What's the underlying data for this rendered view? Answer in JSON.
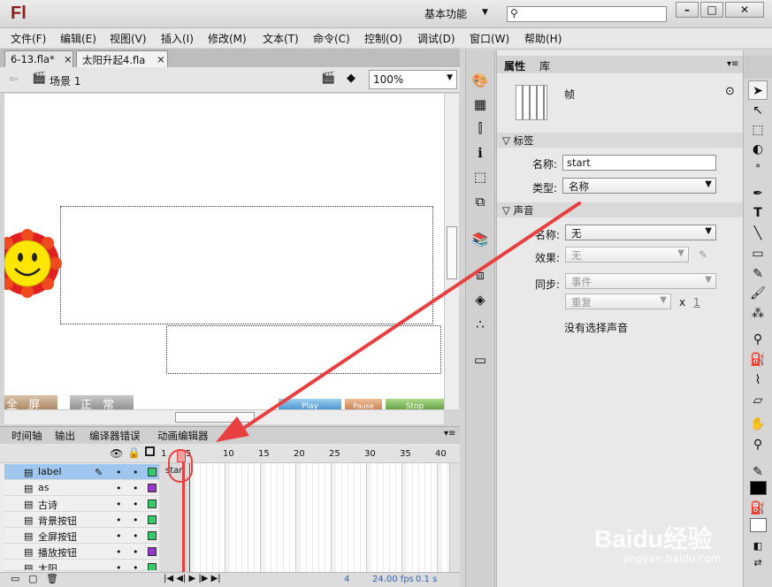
{
  "app": {
    "logo": "Fl",
    "workspace": "基本功能",
    "search_icon": "search-icon",
    "window_buttons": [
      "minimize",
      "maximize",
      "close"
    ]
  },
  "menu": [
    "文件(F)",
    "编辑(E)",
    "视图(V)",
    "插入(I)",
    "修改(M)",
    "文本(T)",
    "命令(C)",
    "控制(O)",
    "调试(D)",
    "窗口(W)",
    "帮助(H)"
  ],
  "tabs": [
    {
      "label": "6-13.fla*",
      "close": "×"
    },
    {
      "label": "太阳升起4.fla",
      "close": "×"
    }
  ],
  "scene": {
    "label": "场景 1",
    "zoom": "100%"
  },
  "stage": {
    "buttons": [
      "全 屏",
      "正 常",
      "Play",
      "Pause",
      "Stop"
    ]
  },
  "timeline": {
    "tabs": [
      "时间轴",
      "输出",
      "编译器错误",
      "动画编辑器"
    ],
    "ruler": [
      "1",
      "5",
      "10",
      "15",
      "20",
      "25",
      "30",
      "35",
      "40"
    ],
    "layers": [
      {
        "name": "label",
        "color": "#33cc66"
      },
      {
        "name": "as",
        "color": "#9933cc"
      },
      {
        "name": "古诗",
        "color": "#33cc66"
      },
      {
        "name": "背景按钮",
        "color": "#33cc66"
      },
      {
        "name": "全屏按钮",
        "color": "#33cc66"
      },
      {
        "name": "播放按钮",
        "color": "#9933cc"
      },
      {
        "name": "太阳",
        "color": "#33cc66"
      }
    ],
    "frame_label": "star",
    "status": {
      "frame": "4",
      "fps": "24.00 fps",
      "time": "0.1 s"
    }
  },
  "properties": {
    "tabs": [
      "属性",
      "库"
    ],
    "type": "帧",
    "label_section": "标签",
    "name_label": "名称:",
    "name_value": "start",
    "type_label": "类型:",
    "type_value": "名称",
    "sound_section": "声音",
    "sound_name_label": "名称:",
    "sound_name_value": "无",
    "effect_label": "效果:",
    "effect_value": "无",
    "sync_label": "同步:",
    "sync_value": "事件",
    "repeat_value": "重复",
    "repeat_x": "x",
    "repeat_count": "1",
    "no_sound": "没有选择声音"
  },
  "watermark": {
    "brand": "Baidu经验",
    "url": "jingyan.baidu.com"
  },
  "colors": {
    "accent_red": "#e84040",
    "selected_layer": "#9ec6ee"
  }
}
